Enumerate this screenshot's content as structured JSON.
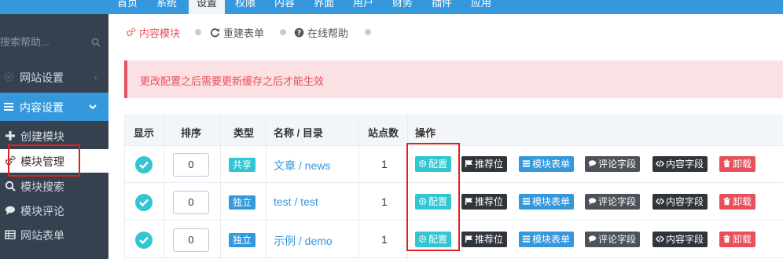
{
  "topnav": {
    "items": [
      {
        "label": "首页",
        "active": false
      },
      {
        "label": "系统",
        "active": false
      },
      {
        "label": "设置",
        "active": true
      },
      {
        "label": "权限",
        "active": false
      },
      {
        "label": "内容",
        "active": false
      },
      {
        "label": "界面",
        "active": false
      },
      {
        "label": "用户",
        "active": false
      },
      {
        "label": "财务",
        "active": false
      },
      {
        "label": "插件",
        "active": false
      },
      {
        "label": "应用",
        "active": false
      }
    ]
  },
  "sidebar": {
    "search_placeholder": "搜索帮助...",
    "site_settings": "网站设置",
    "content_settings": "内容设置",
    "sub_items": [
      {
        "label": "创建模块",
        "icon": "plus-icon"
      },
      {
        "label": "模块管理",
        "icon": "cogs-icon"
      },
      {
        "label": "模块搜索",
        "icon": "search-icon"
      },
      {
        "label": "模块评论",
        "icon": "comments-icon"
      },
      {
        "label": "网站表单",
        "icon": "table-icon"
      }
    ]
  },
  "breadcrumb": {
    "items": [
      {
        "label": "内容模块",
        "icon": "cogs-icon",
        "color": "#e7505a"
      },
      {
        "label": "重建表单",
        "icon": "refresh-icon",
        "color": "#555555"
      },
      {
        "label": "在线帮助",
        "icon": "question-circle-icon",
        "color": "#555555"
      }
    ]
  },
  "alert": {
    "text": "更改配置之后需要更新缓存之后才能生效"
  },
  "table": {
    "headers": [
      "显示",
      "排序",
      "类型",
      "名称 / 目录",
      "站点数",
      "操作"
    ],
    "rows": [
      {
        "sort": "0",
        "type": "共享",
        "type_color": "green",
        "name": "文章 / news",
        "sites": "1"
      },
      {
        "sort": "0",
        "type": "独立",
        "type_color": "blue",
        "name": "test / test",
        "sites": "1"
      },
      {
        "sort": "0",
        "type": "独立",
        "type_color": "blue",
        "name": "示例 / demo",
        "sites": "1"
      }
    ],
    "actions": {
      "config": "配置",
      "recommend": "推荐位",
      "form": "模块表单",
      "comment_fields": "评论字段",
      "content_fields": "内容字段",
      "uninstall": "卸载"
    }
  },
  "colors": {
    "nav_blue": "#3598dc",
    "sidebar_dark": "#364150",
    "teal": "#32c5d2",
    "danger": "#e7505a",
    "dark_btn": "#2f353b",
    "highlight_box": "#e02020"
  }
}
